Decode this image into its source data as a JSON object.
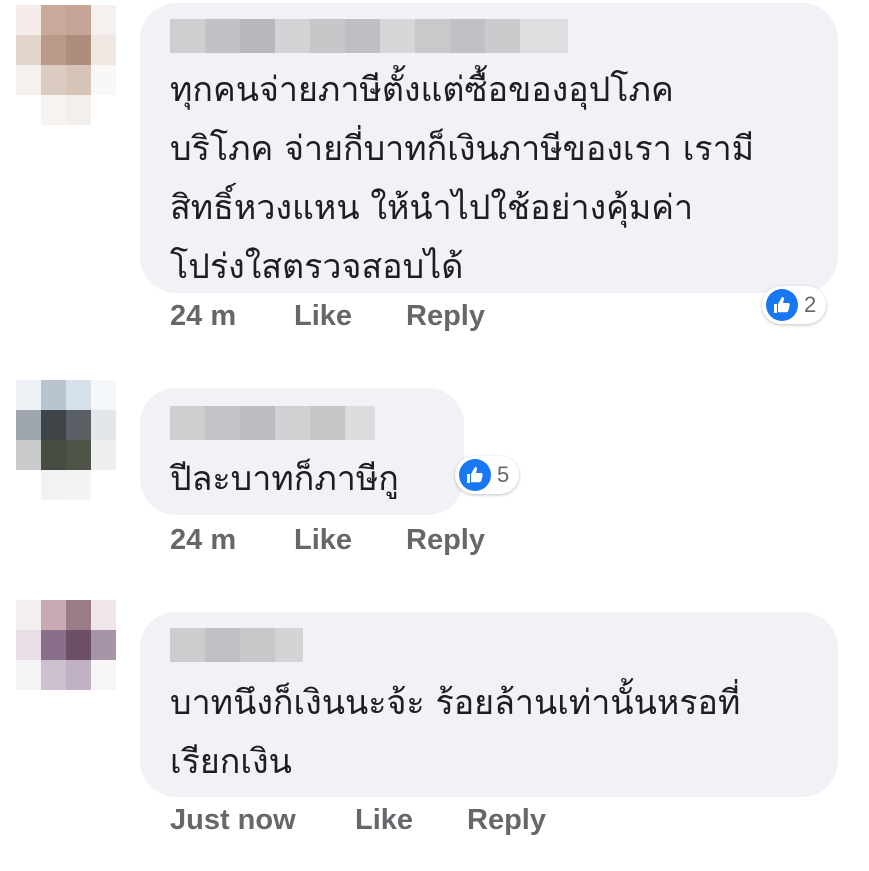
{
  "comments": [
    {
      "text": "ทุกคนจ่ายภาษีตั้งแต่ซื้อของอุปโภค\nบริโภค จ่ายกี่บาทก็เงินภาษีของเรา เรามี\nสิทธิ์หวงแหน ให้นำไปใช้อย่างคุ้มค่า\nโปร่งใสตรวจสอบได้",
      "time": "24 m",
      "like_label": "Like",
      "reply_label": "Reply",
      "reaction_count": "2"
    },
    {
      "text": "ปีละบาทก็ภาษีกู",
      "time": "24 m",
      "like_label": "Like",
      "reply_label": "Reply",
      "reaction_count": "5"
    },
    {
      "text": "บาทนึงก็เงินนะจ้ะ  ร้อยล้านเท่านั้นหรอที่\nเรียกเงิน",
      "time": "Just now",
      "like_label": "Like",
      "reply_label": "Reply"
    }
  ],
  "colors": {
    "bubble": "#f0f2f5",
    "text": "#1c1e21",
    "meta": "#65676b",
    "like_blue": "#1877f2"
  },
  "icons": [
    "like-thumb-icon"
  ]
}
